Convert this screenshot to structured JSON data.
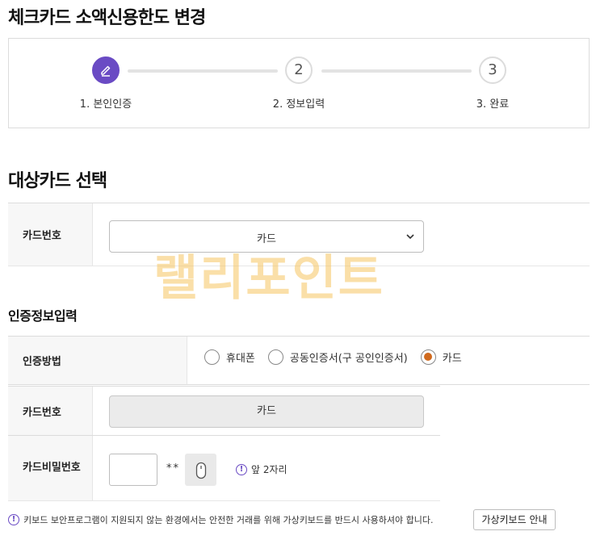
{
  "page": {
    "title": "체크카드 소액신용한도 변경"
  },
  "stepper": {
    "steps": [
      {
        "label": "1. 본인인증",
        "number": "1",
        "active": true
      },
      {
        "label": "2. 정보입력",
        "number": "2",
        "active": false
      },
      {
        "label": "3. 완료",
        "number": "3",
        "active": false
      }
    ]
  },
  "target_card": {
    "title": "대상카드 선택",
    "card_number_label": "카드번호",
    "card_select_value": "카드"
  },
  "auth": {
    "title": "인증정보입력",
    "method_label": "인증방법",
    "methods": [
      {
        "label": "휴대폰",
        "selected": false
      },
      {
        "label": "공동인증서(구 공인인증서)",
        "selected": false
      },
      {
        "label": "카드",
        "selected": true
      }
    ],
    "card_number_label": "카드번호",
    "card_number_value": "카드",
    "password_label": "카드비밀번호",
    "password_mask": "**",
    "password_hint": "앞 2자리"
  },
  "notice": {
    "text": "키보드 보안프로그램이 지원되지 않는 환경에서는 안전한 거래를 위해 가상키보드를 반드시 사용하셔야 합니다.",
    "guide_button": "가상키보드 안내"
  },
  "watermark": {
    "text": "랠리포인트"
  },
  "colors": {
    "accent": "#6a4bc4",
    "radio_selected": "#d06a1e",
    "watermark": "#f6c460"
  }
}
